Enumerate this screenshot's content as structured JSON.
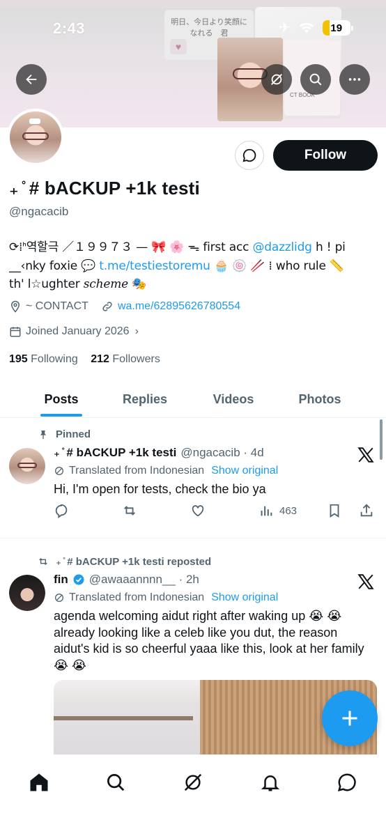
{
  "status_bar": {
    "time": "2:43",
    "battery": "19"
  },
  "banner": {
    "card_text": "明日、今日より笑顔になれる　君",
    "book_text": "CT BOOK"
  },
  "profile": {
    "display_name": "₊ ̊ # bACKUP +1k testi",
    "handle": "@ngacacib",
    "follow_label": "Follow",
    "bio": {
      "line1_pre": "⟳⁞ᑋ역할극 ／１９９７３ — 🎀 🌸 ᯓ first acc ",
      "line1_link": "@dazzlidg",
      "line1_post": " h ! pi",
      "line2_pre": "__‹nky foxie 💬 ",
      "line2_link": "t.me/testiestoremu",
      "line2_post": " 🧁 🍥 🥢 ⁞ who rule 📏",
      "line3_pre": "th' l☆ughter ",
      "line3_em": "scheme",
      "line3_post": " 🎭"
    },
    "location": "~ CONTACT",
    "website": "wa.me/62895626780554",
    "joined": "Joined January 2026",
    "following_count": "195",
    "following_label": "Following",
    "followers_count": "212",
    "followers_label": "Followers"
  },
  "tabs": [
    {
      "label": "Posts"
    },
    {
      "label": "Replies"
    },
    {
      "label": "Videos"
    },
    {
      "label": "Photos"
    }
  ],
  "posts": [
    {
      "context": "Pinned",
      "name": "₊ ̊ # bACKUP +1k testi",
      "meta": "@ngacacib · 4d",
      "translated": "Translated from Indonesian",
      "show_original": "Show original",
      "text": "Hi, I'm open for tests, check the bio ya",
      "views": "463"
    },
    {
      "context": "₊ ̊ # bACKUP +1k testi reposted",
      "name": "fin",
      "meta": "@awaaannnn__ · 2h",
      "translated": "Translated from Indonesian",
      "show_original": "Show original",
      "text": "agenda welcoming aidut right after waking up 😭 😭 already looking like a celeb like you dut, the reason aidut's kid is so cheerful yaaa like this, look at her family 😭 😭"
    }
  ],
  "colors": {
    "accent": "#1d9bf0",
    "text": "#0f1419",
    "muted": "#536471",
    "verified": "#1d9bf0"
  }
}
